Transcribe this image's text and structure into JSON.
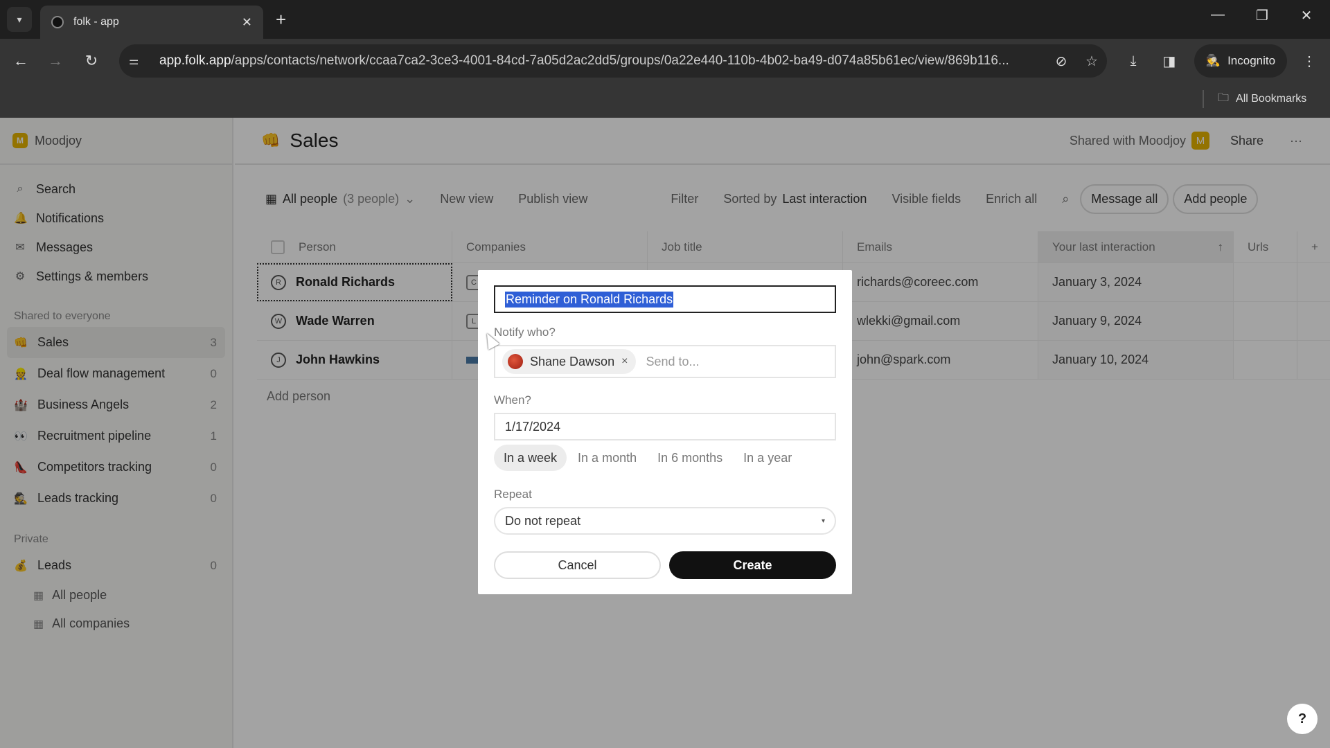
{
  "browser": {
    "tab_title": "folk - app",
    "url_host": "app.folk.app",
    "url_path": "/apps/contacts/network/ccaa7ca2-3ce3-4001-84cd-7a05d2ac2dd5/groups/0a22e440-110b-4b02-ba49-d074a85b61ec/view/869b116...",
    "incognito_label": "Incognito",
    "bookmarks_label": "All Bookmarks",
    "icons": {
      "tab_list": "▾",
      "close": "✕",
      "new_tab": "+",
      "minimize": "—",
      "restore": "❐",
      "window_close": "✕",
      "back": "←",
      "forward": "→",
      "reload": "↻",
      "site_info": "⚌",
      "eye_off": "⊘",
      "star": "☆",
      "download": "⤓",
      "side_panel": "◨",
      "incognito": "🕵",
      "menu": "⋮",
      "folder": "🗀"
    }
  },
  "sidebar": {
    "workspace": {
      "initial": "M",
      "name": "Moodjoy"
    },
    "nav": [
      {
        "icon": "⌕",
        "label": "Search"
      },
      {
        "icon": "🔔",
        "label": "Notifications"
      },
      {
        "icon": "✉",
        "label": "Messages"
      },
      {
        "icon": "⚙",
        "label": "Settings & members"
      }
    ],
    "shared_label": "Shared to everyone",
    "shared_groups": [
      {
        "emoji": "👊",
        "label": "Sales",
        "count": "3",
        "active": true
      },
      {
        "emoji": "👷",
        "label": "Deal flow management",
        "count": "0"
      },
      {
        "emoji": "🏰",
        "label": "Business Angels",
        "count": "2"
      },
      {
        "emoji": "👀",
        "label": "Recruitment pipeline",
        "count": "1"
      },
      {
        "emoji": "👠",
        "label": "Competitors tracking",
        "count": "0"
      },
      {
        "emoji": "🕵",
        "label": "Leads tracking",
        "count": "0"
      }
    ],
    "private_label": "Private",
    "private_groups": [
      {
        "emoji": "💰",
        "label": "Leads",
        "count": "0"
      }
    ],
    "sub_items": [
      {
        "icon": "▦",
        "label": "All people"
      },
      {
        "icon": "▦",
        "label": "All companies"
      }
    ]
  },
  "header": {
    "emoji": "👊",
    "title": "Sales",
    "shared_with": "Shared with Moodjoy",
    "shared_badge": "M",
    "share_label": "Share",
    "more_label": "···"
  },
  "toolbar": {
    "view_icon": "▦",
    "view_label": "All people",
    "view_count": "(3 people)",
    "view_caret": "⌄",
    "new_view": "New view",
    "publish_view": "Publish view",
    "filter": "Filter",
    "sorted_by_prefix": "Sorted by",
    "sorted_by_value": "Last interaction",
    "visible_fields": "Visible fields",
    "enrich_all": "Enrich all",
    "search_icon": "⌕",
    "message_all": "Message all",
    "add_people": "Add people"
  },
  "table": {
    "columns": [
      "Person",
      "Companies",
      "Job title",
      "Emails",
      "Your last interaction",
      "Urls"
    ],
    "sort_icon": "↑",
    "add_column_icon": "+",
    "rows": [
      {
        "initial": "R",
        "name": "Ronald Richards",
        "company_chip": "C",
        "job_title": "",
        "email": "richards@coreec.com",
        "last_interaction": "January 3, 2024",
        "urls": ""
      },
      {
        "initial": "W",
        "name": "Wade Warren",
        "company_chip": "L",
        "job_title": "",
        "email": "wlekki@gmail.com",
        "last_interaction": "January 9, 2024",
        "urls": ""
      },
      {
        "initial": "J",
        "name": "John Hawkins",
        "company_chip": "",
        "job_title": "",
        "email": "john@spark.com",
        "last_interaction": "January 10, 2024",
        "urls": ""
      }
    ],
    "add_person": "Add person"
  },
  "reminder_modal": {
    "title_value": "Reminder on Ronald Richards",
    "notify_label": "Notify who?",
    "recipients": [
      {
        "name": "Shane Dawson"
      }
    ],
    "recipient_remove_icon": "×",
    "notify_placeholder": "Send to...",
    "when_label": "When?",
    "date_value": "1/17/2024",
    "quick_options": [
      {
        "label": "In a week",
        "active": true
      },
      {
        "label": "In a month",
        "active": false
      },
      {
        "label": "In 6 months",
        "active": false
      },
      {
        "label": "In a year",
        "active": false
      }
    ],
    "repeat_label": "Repeat",
    "repeat_value": "Do not repeat",
    "repeat_caret": "▾",
    "cancel_label": "Cancel",
    "create_label": "Create"
  },
  "help_label": "?"
}
